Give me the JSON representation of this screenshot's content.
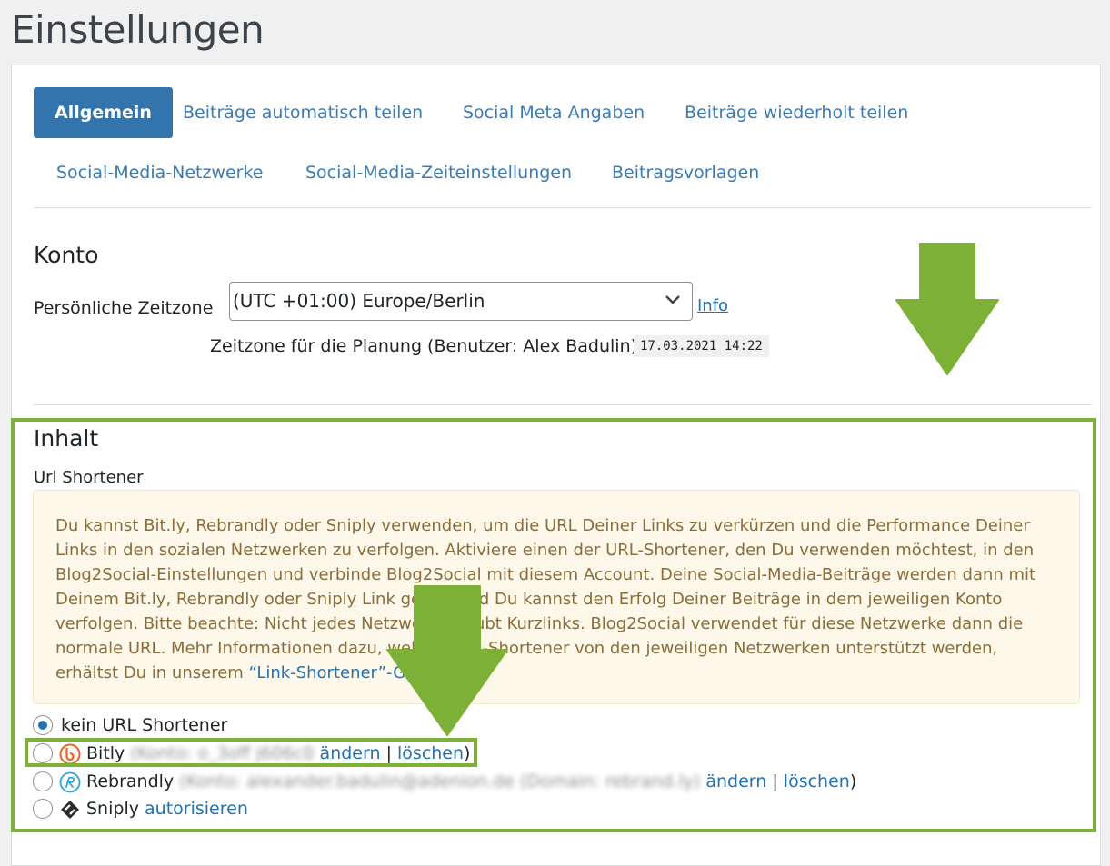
{
  "page": {
    "title": "Einstellungen"
  },
  "tabs": [
    {
      "label": "Allgemein",
      "active": true
    },
    {
      "label": "Beiträge automatisch teilen"
    },
    {
      "label": "Social Meta Angaben"
    },
    {
      "label": "Beiträge wiederholt teilen"
    },
    {
      "label": "Social-Media-Netzwerke"
    },
    {
      "label": "Social-Media-Zeiteinstellungen"
    },
    {
      "label": "Beitragsvorlagen"
    }
  ],
  "konto": {
    "title": "Konto",
    "timezone_label": "Persönliche Zeitzone",
    "timezone_value": "(UTC +01:00) Europe/Berlin",
    "info_link": "Info",
    "planning_label": "Zeitzone für die Planung (Benutzer: Alex Badulin)",
    "datetime": "17.03.2021 14:22"
  },
  "inhalt": {
    "title": "Inhalt",
    "shortener_label": "Url Shortener",
    "notice_text": "Du kannst Bit.ly, Rebrandly oder Sniply verwenden, um die URL Deiner Links zu verkürzen und die Performance Deiner Links in den sozialen Netzwerken zu verfolgen. Aktiviere einen der URL-Shortener, den Du verwenden möchtest, in den Blog2Social-Einstellungen und verbinde Blog2Social mit diesem Account. Deine Social-Media-Beiträge werden dann mit Deinem Bit.ly, Rebrandly oder Sniply Link geteilt und Du kannst den Erfolg Deiner Beiträge in dem jeweiligen Konto verfolgen. Bitte beachte: Nicht jedes Netzwerk erlaubt Kurzlinks. Blog2Social verwendet für diese Netzwerke dann die normale URL. Mehr Informationen dazu, welche URL-Shortener von den jeweiligen Netzwerken unterstützt werden, erhältst Du in unserem",
    "notice_link": "“Link-Shortener”-Guide",
    "notice_end": ".",
    "options": {
      "none": {
        "label": "kein URL Shortener",
        "checked": true
      },
      "bitly": {
        "label": "Bitly",
        "account": "(Konto: o_3off j606c0",
        "change": "ändern",
        "sep": "|",
        "delete": "löschen",
        "close": ")"
      },
      "rebrandly": {
        "label": "Rebrandly",
        "account": "(Konto: alexander.badulin@adenion.de (Domain: rebrand.ly)",
        "change": "ändern",
        "sep": "|",
        "delete": "löschen",
        "close": ")"
      },
      "sniply": {
        "label": "Sniply",
        "authorize": "autorisieren"
      }
    }
  },
  "colors": {
    "accent": "#3274ab",
    "link": "#2271b1",
    "notice_bg": "#fdf8e9",
    "notice_text": "#8a6d3b",
    "annotation_green": "#7db037"
  }
}
